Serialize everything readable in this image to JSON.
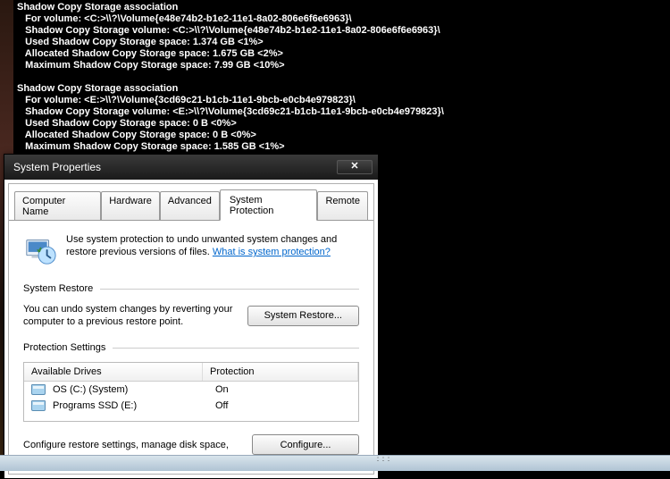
{
  "console": {
    "block1": {
      "heading": "Shadow Copy Storage association",
      "l1": "   For volume: <C:>\\\\?\\Volume{e48e74b2-b1e2-11e1-8a02-806e6f6e6963}\\",
      "l2": "   Shadow Copy Storage volume: <C:>\\\\?\\Volume{e48e74b2-b1e2-11e1-8a02-806e6f6e6963}\\",
      "l3": "   Used Shadow Copy Storage space: 1.374 GB <1%>",
      "l4": "   Allocated Shadow Copy Storage space: 1.675 GB <2%>",
      "l5": "   Maximum Shadow Copy Storage space: 7.99 GB <10%>"
    },
    "block2": {
      "heading": "Shadow Copy Storage association",
      "l1": "   For volume: <E:>\\\\?\\Volume{3cd69c21-b1cb-11e1-9bcb-e0cb4e979823}\\",
      "l2": "   Shadow Copy Storage volume: <E:>\\\\?\\Volume{3cd69c21-b1cb-11e1-9bcb-e0cb4e979823}\\",
      "l3": "   Used Shadow Copy Storage space: 0 B <0%>",
      "l4": "   Allocated Shadow Copy Storage space: 0 B <0%>",
      "l5": "   Maximum Shadow Copy Storage space: 1.585 GB <1%>"
    }
  },
  "dialog": {
    "title": "System Properties",
    "close": "✕",
    "tabs": {
      "computer_name": "Computer Name",
      "hardware": "Hardware",
      "advanced": "Advanced",
      "system_protection": "System Protection",
      "remote": "Remote"
    },
    "intro_text": "Use system protection to undo unwanted system changes and restore previous versions of files. ",
    "intro_link": "What is system protection?",
    "group_restore": {
      "legend": "System Restore",
      "text": "You can undo system changes by reverting your computer to a previous restore point.",
      "button": "System Restore..."
    },
    "group_settings": {
      "legend": "Protection Settings",
      "col_drives": "Available Drives",
      "col_protection": "Protection",
      "rows": [
        {
          "name": "OS (C:) (System)",
          "protection": "On"
        },
        {
          "name": "Programs SSD (E:)",
          "protection": "Off"
        }
      ],
      "configure_text": "Configure restore settings, manage disk space,",
      "configure_button": "Configure..."
    }
  },
  "taskbar": {
    "dots": "꞉꞉꞉"
  }
}
